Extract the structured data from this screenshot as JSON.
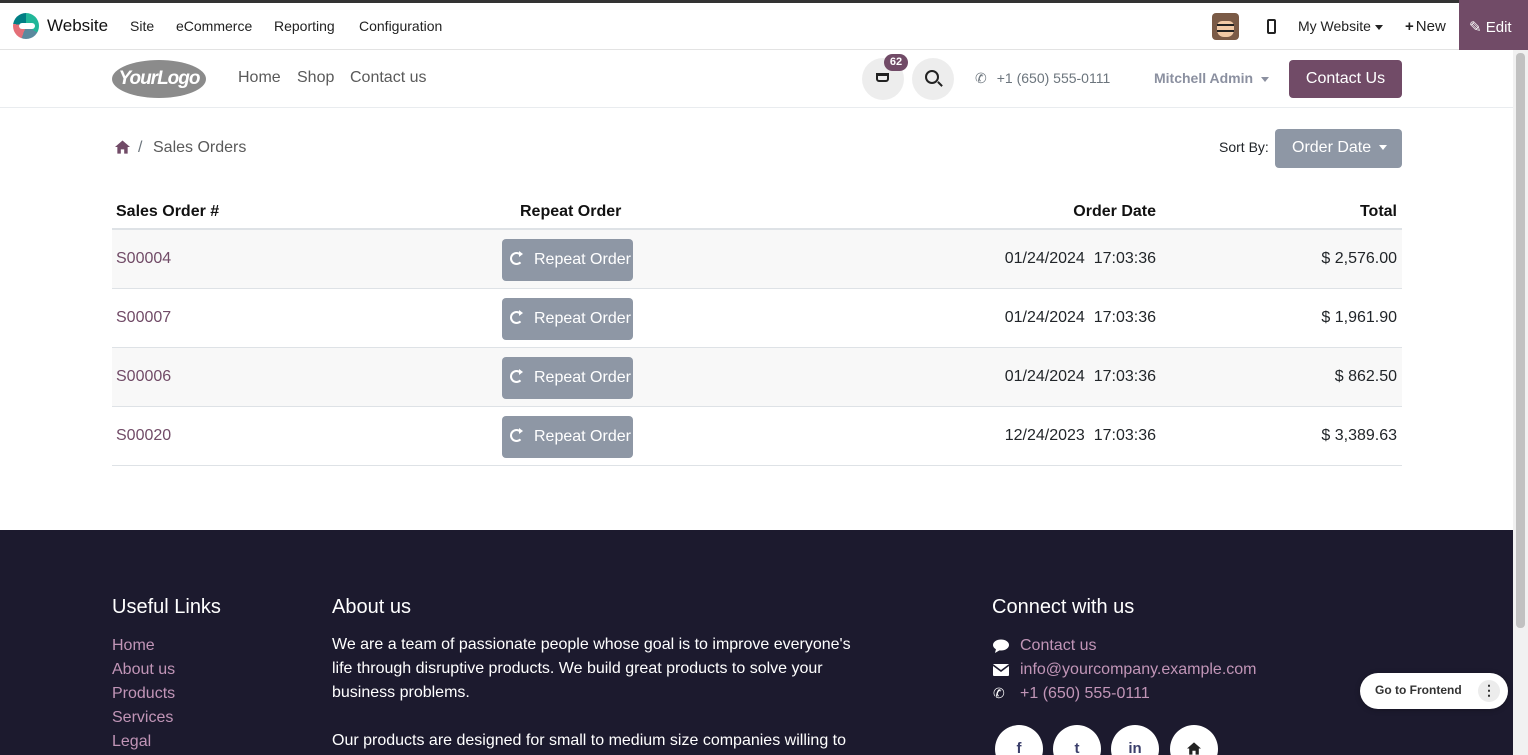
{
  "topbar": {
    "app_name": "Website",
    "menu": [
      "Site",
      "eCommerce",
      "Reporting",
      "Configuration"
    ],
    "website_selector": "My Website",
    "new_label": "New",
    "edit_label": "Edit"
  },
  "header": {
    "logo_text": "YourLogo",
    "nav": [
      "Home",
      "Shop",
      "Contact us"
    ],
    "cart_count": "62",
    "phone": "+1 (650) 555-0111",
    "user": "Mitchell Admin",
    "contact_button": "Contact Us"
  },
  "breadcrumb": {
    "current": "Sales Orders",
    "separator": "/"
  },
  "sort": {
    "label": "Sort By:",
    "value": "Order Date"
  },
  "table": {
    "headers": [
      "Sales Order #",
      "Repeat Order",
      "Order Date",
      "Total"
    ],
    "repeat_label": "Repeat Order",
    "rows": [
      {
        "order": "S00004",
        "date": "01/24/2024  17:03:36",
        "total": "$ 2,576.00"
      },
      {
        "order": "S00007",
        "date": "01/24/2024  17:03:36",
        "total": "$ 1,961.90"
      },
      {
        "order": "S00006",
        "date": "01/24/2024  17:03:36",
        "total": "$ 862.50"
      },
      {
        "order": "S00020",
        "date": "12/24/2023  17:03:36",
        "total": "$ 3,389.63"
      }
    ]
  },
  "footer": {
    "useful_links_title": "Useful Links",
    "useful_links": [
      "Home",
      "About us",
      "Products",
      "Services",
      "Legal"
    ],
    "about_title": "About us",
    "about_p1": "We are a team of passionate people whose goal is to improve everyone's life through disruptive products. We build great products to solve your business problems.",
    "about_p2": "Our products are designed for small to medium size companies willing to",
    "connect_title": "Connect with us",
    "connect": {
      "contact": "Contact us",
      "email": "info@yourcompany.example.com",
      "phone": "+1 (650) 555-0111"
    },
    "social": [
      "f",
      "t",
      "in",
      "home"
    ]
  },
  "floating": {
    "go_frontend": "Go to Frontend"
  },
  "colors": {
    "brand": "#714b67",
    "button_gray": "#8e97a5",
    "footer_bg": "#1c1a2e",
    "footer_link": "#c195b7"
  }
}
